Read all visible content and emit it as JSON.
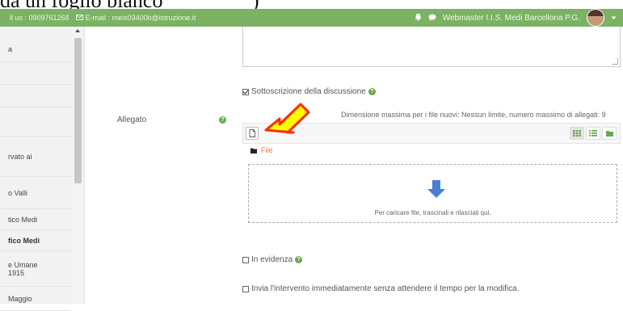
{
  "doc_fragment": {
    "left": "da un foglio bianco",
    "right": ")"
  },
  "topbar": {
    "phone": "ll us : 0909761268",
    "email": "E-mail : meis03400b@istruzione.it",
    "user_name": "Webmaster I.I.S. Medi Barcellona P.G."
  },
  "sidebar": {
    "items": [
      {
        "label": "a"
      },
      {
        "label": ""
      },
      {
        "label": ""
      },
      {
        "label": ""
      },
      {
        "label": "rvato ai"
      },
      {
        "label": "o Valli"
      },
      {
        "label": "tico Medi"
      },
      {
        "label": "fico Medi"
      },
      {
        "label": "e Umane\n1915"
      },
      {
        "label": "Maggio"
      }
    ]
  },
  "form": {
    "subscribe_label": "Sottoscrizione della discussione",
    "subscribe_checked": true,
    "attachment_label": "Allegato",
    "max_size_text": "Dimensione massima per i file nuovi: Nessun limite, numero massimo di allegati: 9",
    "path_label": "File",
    "drop_text": "Per caricare file, trascinali e rilasciali qui.",
    "pinned_label": "In evidenza",
    "pinned_checked": false,
    "send_now_label": "Invia l'intervento immediatamente senza attendere il tempo per la modifica.",
    "send_now_checked": false
  },
  "colors": {
    "topbar": "#7bb263",
    "accent_green": "#6aa84f",
    "drop_arrow": "#4a7fd6",
    "highlight_fill": "#ffff00",
    "highlight_stroke": "#ff2a00"
  }
}
